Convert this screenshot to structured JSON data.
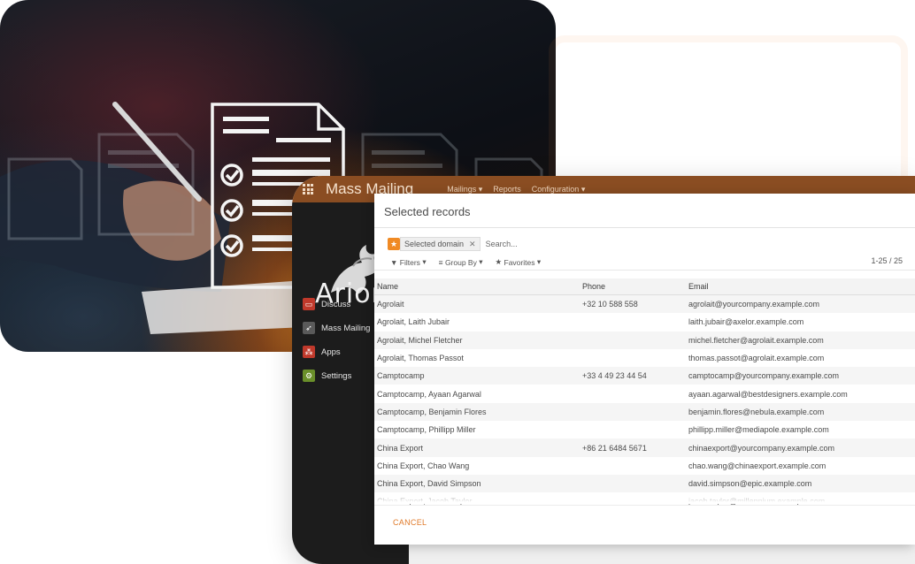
{
  "app": {
    "title": "Mass Mailing",
    "menus": [
      "Mailings",
      "Reports",
      "Configuration"
    ],
    "menu_caret": "▾",
    "logo_text": "Arion"
  },
  "sidebar": {
    "items": [
      {
        "label": "Discuss",
        "icon": "chat-icon",
        "color": "#c0392b"
      },
      {
        "label": "Mass Mailing",
        "icon": "paper-plane-icon",
        "color": "#5a5a5a"
      },
      {
        "label": "Apps",
        "icon": "apps-icon",
        "color": "#c0392b"
      },
      {
        "label": "Settings",
        "icon": "gear-icon",
        "color": "#6a8f2a"
      }
    ]
  },
  "dialog": {
    "title": "Selected records",
    "facet_label": "Selected domain",
    "search_placeholder": "Search...",
    "filters_label": "Filters",
    "groupby_label": "Group By",
    "favorites_label": "Favorites",
    "pager": "1-25 / 25",
    "cancel_label": "CANCEL",
    "columns": {
      "name": "Name",
      "phone": "Phone",
      "email": "Email"
    },
    "rows": [
      {
        "name": "Agrolait",
        "phone": "+32 10 588 558",
        "email": "agrolait@yourcompany.example.com"
      },
      {
        "name": "Agrolait, Laith Jubair",
        "phone": "",
        "email": "laith.jubair@axelor.example.com"
      },
      {
        "name": "Agrolait, Michel Fletcher",
        "phone": "",
        "email": "michel.fletcher@agrolait.example.com"
      },
      {
        "name": "Agrolait, Thomas Passot",
        "phone": "",
        "email": "thomas.passot@agrolait.example.com"
      },
      {
        "name": "Camptocamp",
        "phone": "+33 4 49 23 44 54",
        "email": "camptocamp@yourcompany.example.com"
      },
      {
        "name": "Camptocamp, Ayaan Agarwal",
        "phone": "",
        "email": "ayaan.agarwal@bestdesigners.example.com"
      },
      {
        "name": "Camptocamp, Benjamin Flores",
        "phone": "",
        "email": "benjamin.flores@nebula.example.com"
      },
      {
        "name": "Camptocamp, Phillipp Miller",
        "phone": "",
        "email": "phillipp.miller@mediapole.example.com"
      },
      {
        "name": "China Export",
        "phone": "+86 21 6484 5671",
        "email": "chinaexport@yourcompany.example.com"
      },
      {
        "name": "China Export, Chao Wang",
        "phone": "",
        "email": "chao.wang@chinaexport.example.com"
      },
      {
        "name": "China Export, David Simpson",
        "phone": "",
        "email": "david.simpson@epic.example.com"
      },
      {
        "name": "China Export, Jacob Taylor",
        "phone": "",
        "email": "jacob.taylor@millennium.example.com"
      }
    ]
  },
  "colors": {
    "topbar": "#8a4d22",
    "accent": "#f08a24",
    "cancel": "#e07a2a",
    "sidebar": "#1c1c1c"
  }
}
